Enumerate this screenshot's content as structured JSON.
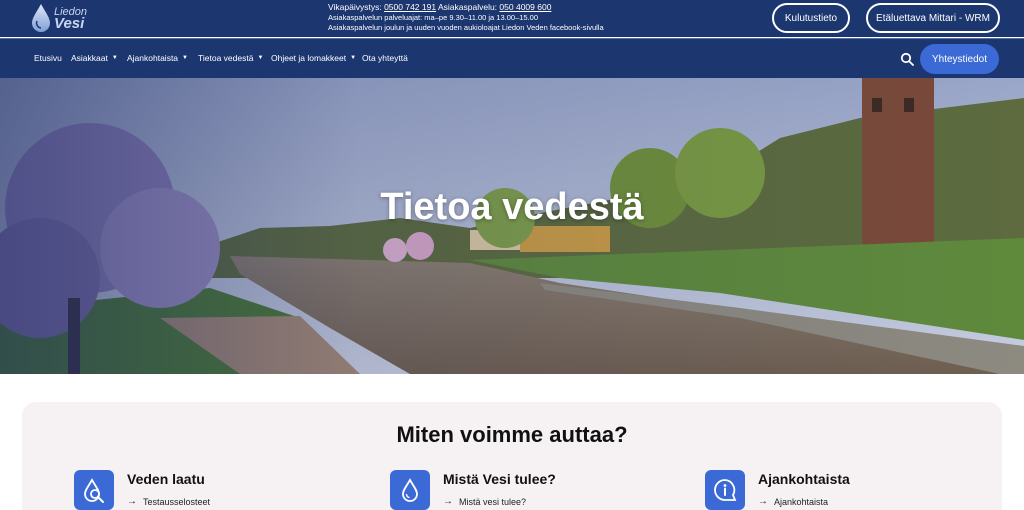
{
  "topbar": {
    "logo": {
      "line1": "Liedon",
      "line2": "Vesi"
    },
    "faults_label": "Vikapäivystys:",
    "faults_phone": "0500 742 191",
    "service_label": "Asiakaspalvelu:",
    "service_phone": "050 4009 600",
    "hours": "Asiakaspalvelun palveluajat: ma–pe 9.30–11.00 ja 13.00–15.00",
    "holiday_note": "Asiakaspalvelun joulun ja uuden vuoden aukioloajat Liedon Veden facebook-sivulla",
    "kulutus_label": "Kulutustieto",
    "mittari_label": "Etäluettava Mittari - WRM"
  },
  "nav": {
    "items": [
      "Etusivu",
      "Asiakkaat",
      "Ajankohtaista",
      "Tietoa vedestä",
      "Ohjeet ja lomakkeet",
      "Ota yhteyttä"
    ],
    "caret": "▼",
    "contact_label": "Yhteystiedot"
  },
  "hero": {
    "title": "Tietoa vedestä"
  },
  "help": {
    "title": "Miten voimme auttaa?",
    "arrow": "→",
    "cards": [
      {
        "title": "Veden laatu",
        "link": "Testausselosteet",
        "icon": "water-quality-icon"
      },
      {
        "title": "Mistä Vesi tulee?",
        "link": "Mistä vesi tulee?",
        "icon": "water-drop-icon"
      },
      {
        "title": "Ajankohtaista",
        "link": "Ajankohtaista",
        "icon": "info-bubble-icon"
      }
    ]
  },
  "colors": {
    "navy": "#1c3670",
    "accent": "#3b6ad6",
    "section_bg": "#f6f2f3"
  }
}
